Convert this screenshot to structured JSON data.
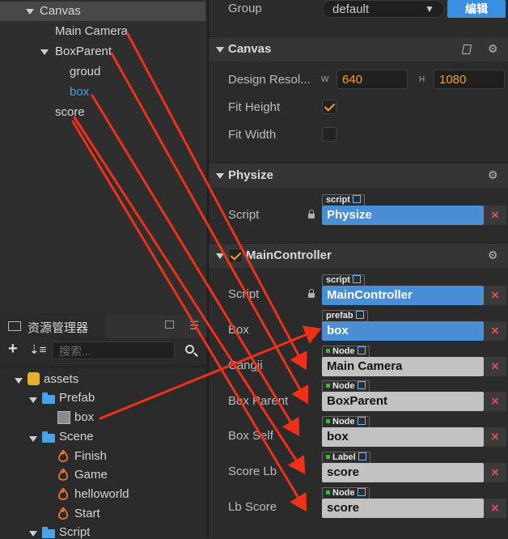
{
  "hierarchy": {
    "canvas": "Canvas",
    "main_camera": "Main Camera",
    "box_parent": "BoxParent",
    "groud": "groud",
    "box": "box",
    "score": "score"
  },
  "assets": {
    "title": "资源管理器",
    "search_placeholder": "搜索...",
    "items": {
      "assets": "assets",
      "prefab": "Prefab",
      "box": "box",
      "scene": "Scene",
      "finish": "Finish",
      "game": "Game",
      "helloworld": "helloworld",
      "start": "Start",
      "script": "Script"
    }
  },
  "inspector": {
    "group_label": "Group",
    "group_value": "default",
    "edit_button": "编辑",
    "canvas": {
      "title": "Canvas",
      "design_label": "Design Resol...",
      "w_label": "W",
      "w_value": "640",
      "h_label": "H",
      "h_value": "1080",
      "fit_height_label": "Fit Height",
      "fit_height": true,
      "fit_width_label": "Fit Width",
      "fit_width": false
    },
    "physize": {
      "title": "Physize",
      "script_label": "Script",
      "script_tag": "script",
      "script_value": "Physize"
    },
    "main_controller": {
      "title": "MainController",
      "script_label": "Script",
      "script_tag": "script",
      "script_value": "MainController",
      "fields": [
        {
          "label": "Box",
          "tag": "prefab",
          "value": "box"
        },
        {
          "label": "Cangji",
          "tag": "Node",
          "value": "Main Camera"
        },
        {
          "label": "Box Parent",
          "tag": "Node",
          "value": "BoxParent"
        },
        {
          "label": "Box Self",
          "tag": "Node",
          "value": "box"
        },
        {
          "label": "Score Lb",
          "tag": "Label",
          "value": "score"
        },
        {
          "label": "Lb Score",
          "tag": "Node",
          "value": "score"
        }
      ]
    }
  },
  "colors": {
    "accent_orange": "#f0a030",
    "ref_blue": "#4a8ed6",
    "arrow_red": "#f03018",
    "selection_blue": "#4a9be8"
  }
}
